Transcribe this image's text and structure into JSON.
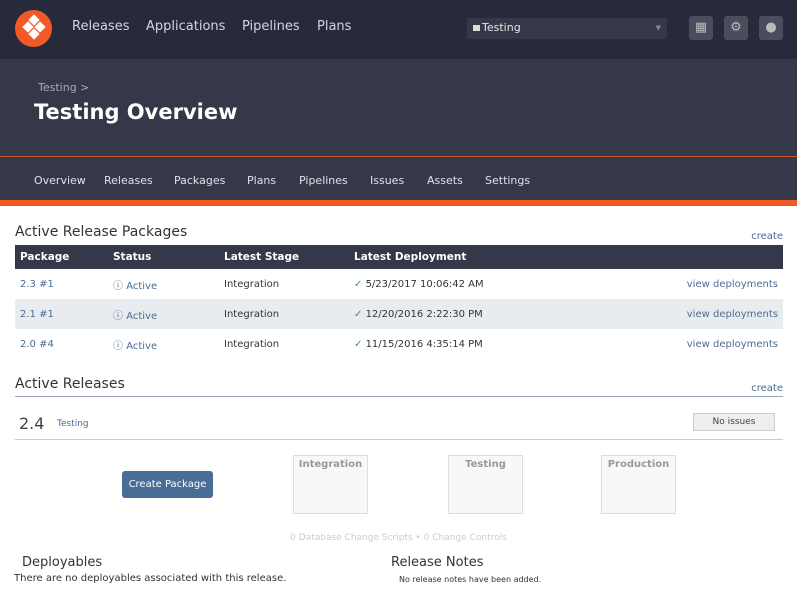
{
  "nav": {
    "items": [
      "Releases",
      "Applications",
      "Pipelines",
      "Plans"
    ],
    "environment": "Testing"
  },
  "header": {
    "breadcrumb": "Testing >",
    "title": "Testing Overview"
  },
  "subnav": [
    "Overview",
    "Releases",
    "Packages",
    "Plans",
    "Pipelines",
    "Issues",
    "Assets",
    "Settings"
  ],
  "packages": {
    "title": "Active Release Packages",
    "create": "create",
    "columns": [
      "Package",
      "Status",
      "Latest Stage",
      "Latest Deployment"
    ],
    "rows": [
      {
        "package": "2.3 #1",
        "status": "Active",
        "stage": "Integration",
        "deployment": "5/23/2017 10:06:42 AM",
        "action": "view deployments"
      },
      {
        "package": "2.1 #1",
        "status": "Active",
        "stage": "Integration",
        "deployment": "12/20/2016 2:22:30 PM",
        "action": "view deployments"
      },
      {
        "package": "2.0 #4",
        "status": "Active",
        "stage": "Integration",
        "deployment": "11/15/2016 4:35:14 PM",
        "action": "view deployments"
      }
    ]
  },
  "releases": {
    "title": "Active Releases",
    "create": "create",
    "version": "2.4",
    "tag": "Testing",
    "issues": "No issues",
    "create_package": "Create Package",
    "stages": [
      "Integration",
      "Testing",
      "Production"
    ],
    "meta": "0 Database Change Scripts • 0 Change Controls",
    "deployables_title": "Deployables",
    "deployables_text": "There are no deployables associated with this release.",
    "notes_title": "Release Notes",
    "notes_text": "No release notes have been added."
  }
}
